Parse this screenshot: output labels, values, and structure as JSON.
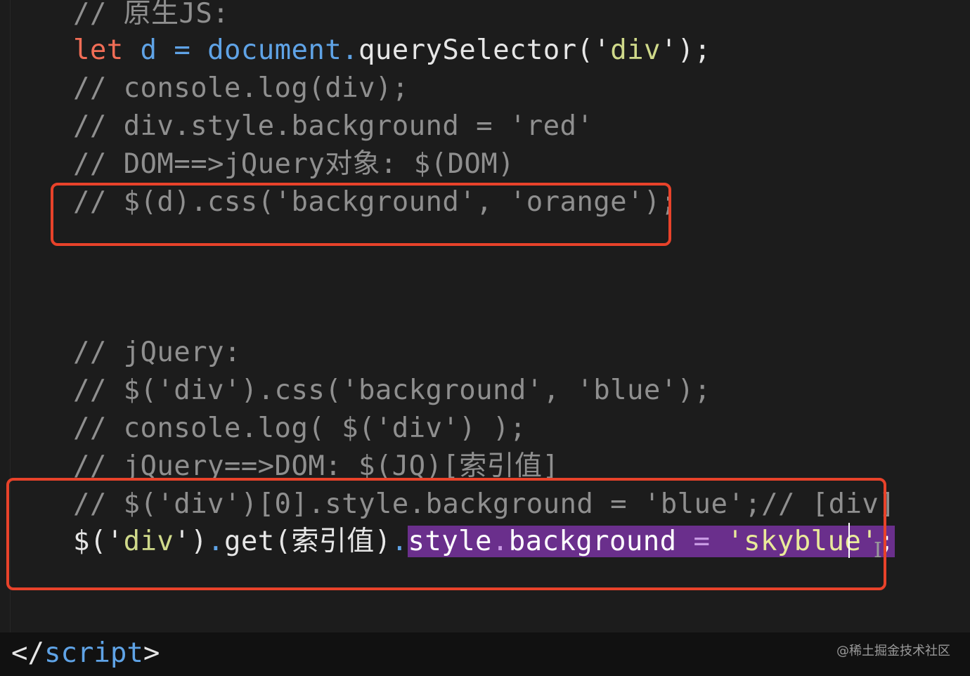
{
  "code": {
    "l1": {
      "comment": "// 原生JS:"
    },
    "l2": {
      "kw": "let",
      "var": "d",
      "op": "=",
      "obj": "document",
      "dot": ".",
      "method": "querySelector(",
      "q1": "'",
      "str": "div",
      "q2": "'",
      "end": ");"
    },
    "l3": {
      "comment": "// console.log(div);"
    },
    "l4": {
      "comment": "// div.style.background = 'red'"
    },
    "l5": {
      "comment": "// DOM==>jQuery对象: $(DOM)"
    },
    "l6": {
      "comment": "// $(d).css('background', 'orange');"
    },
    "l7": {
      "comment": "// jQuery:"
    },
    "l8": {
      "comment": "// $('div').css('background', 'blue');"
    },
    "l9": {
      "comment": "// console.log( $('div') );"
    },
    "l10": {
      "comment": "// jQuery==>DOM: $(JQ)[索引值]"
    },
    "l11": {
      "comment": "// $('div')[0].style.background = 'blue';// [div]"
    },
    "l12": {
      "start": "$(",
      "q1": "'",
      "str": "div",
      "q2": "'",
      "close": ")",
      "dot": ".",
      "call": "get(索引值)",
      "dot2": ".",
      "sel_prop1": "style",
      "sel_dot": ".",
      "sel_prop2": "background",
      "sel_op": " = ",
      "sel_q1": "'",
      "sel_str": "skyblue",
      "sel_q2": "'",
      "sel_end": ";"
    },
    "closing_tag": {
      "open": "</",
      "name": "script",
      "close": ">"
    }
  },
  "watermark": "@稀土掘金技术社区",
  "colors": {
    "background": "#1c1c1c",
    "comment": "#8f8f8f",
    "keyword": "#f26d56",
    "identifier": "#5fa3e6",
    "string": "#cfd98a",
    "selection": "#6a2f8c",
    "highlight_box": "#e8422a"
  }
}
